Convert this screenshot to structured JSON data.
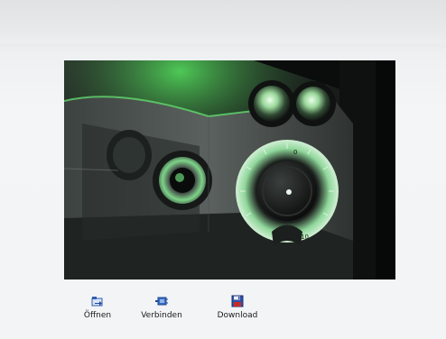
{
  "photo": {
    "dial_labels": [
      "0",
      "10"
    ]
  },
  "toolbar": {
    "items": [
      {
        "label": "Öffnen",
        "icon": "open-folder-arrow-icon"
      },
      {
        "label": "Verbinden",
        "icon": "connect-plug-icon"
      },
      {
        "label": "Download",
        "icon": "save-floppy-icon"
      }
    ]
  },
  "colors": {
    "background": "#f2f4f6",
    "accent_green": "#39d84a",
    "icon_blue": "#2f5fb0",
    "icon_red": "#c62a2a"
  }
}
